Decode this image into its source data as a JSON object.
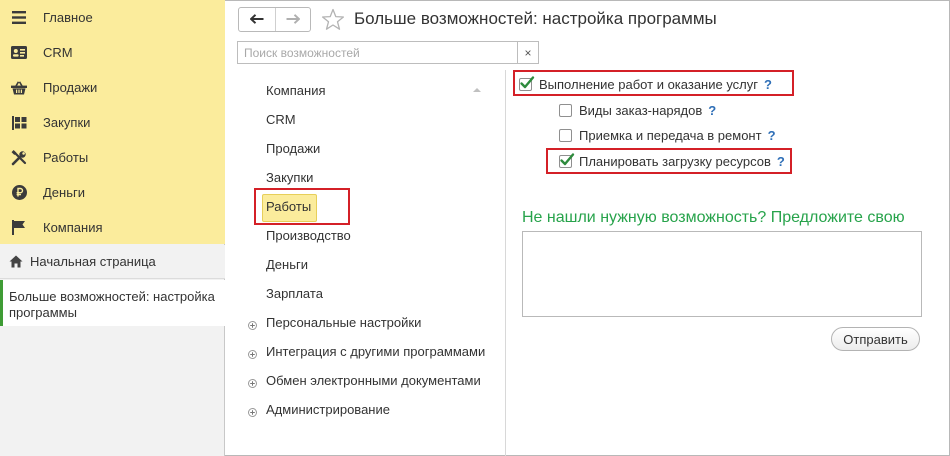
{
  "sidebar": {
    "sections": [
      {
        "label": "Главное",
        "icon": "menu-icon"
      },
      {
        "label": "CRM",
        "icon": "contact-card-icon"
      },
      {
        "label": "Продажи",
        "icon": "basket-icon"
      },
      {
        "label": "Закупки",
        "icon": "goods-grid-icon"
      },
      {
        "label": "Работы",
        "icon": "tools-icon"
      },
      {
        "label": "Деньги",
        "icon": "ruble-coin-icon"
      },
      {
        "label": "Компания",
        "icon": "flag-icon"
      }
    ],
    "home": {
      "label": "Начальная страница",
      "icon": "home-icon"
    },
    "open_window": "Больше возможностей: настройка программы"
  },
  "header": {
    "title": "Больше возможностей: настройка программы",
    "back_icon": "arrow-left-icon",
    "forward_icon": "arrow-right-icon",
    "favorite_icon": "star-icon"
  },
  "search": {
    "placeholder": "Поиск возможностей",
    "value": "",
    "clear_label": "×"
  },
  "categories": {
    "items": [
      "Компания",
      "CRM",
      "Продажи",
      "Закупки",
      "Работы",
      "Производство",
      "Деньги",
      "Зарплата"
    ],
    "selected": "Работы",
    "expandable": [
      "Персональные настройки",
      "Интеграция с другими программами",
      "Обмен электронными документами",
      "Администрирование"
    ]
  },
  "options": [
    {
      "label": "Выполнение работ и оказание услуг",
      "checked": true,
      "help": "?"
    },
    {
      "label": "Виды заказ-нарядов",
      "checked": false,
      "help": "?"
    },
    {
      "label": "Приемка и передача в ремонт",
      "checked": false,
      "help": "?"
    },
    {
      "label": "Планировать загрузку ресурсов",
      "checked": true,
      "help": "?"
    }
  ],
  "suggestion": {
    "title": "Не нашли нужную возможность? Предложите свою",
    "text": "",
    "send_label": "Отправить"
  },
  "colors": {
    "section_panel": "#fbec9c",
    "accent_green": "#27a34b",
    "highlight_red": "#d42027",
    "help_blue": "#2f6fb7"
  }
}
